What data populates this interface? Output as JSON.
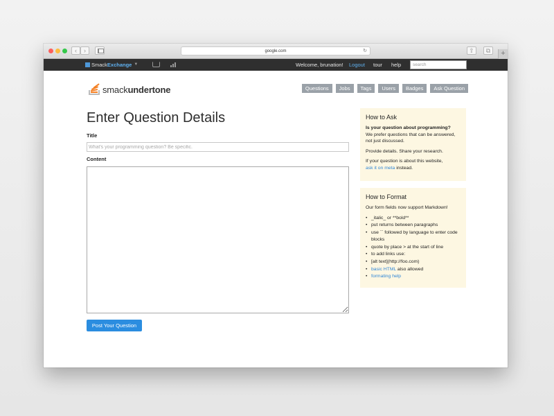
{
  "browser": {
    "url": "google.com",
    "traffic_colors": [
      "#fc605c",
      "#fdbc40",
      "#34c84a"
    ],
    "back_icon": "‹",
    "forward_icon": "›",
    "reload_icon": "↻",
    "share_icon": "⇪",
    "tabs_icon": "⧉",
    "new_tab_icon": "+"
  },
  "topbar": {
    "brand_a": "Smack",
    "brand_b": "Exchange",
    "caret": "▼",
    "welcome": "Welcome, brunation!",
    "logout": "Logout",
    "tour": "tour",
    "help": "help",
    "search_placeholder": "search",
    "accent": "#5fb0ef"
  },
  "site": {
    "name_a": "smack",
    "name_b": "undertone",
    "nav": [
      "Questions",
      "Jobs",
      "Tags",
      "Users",
      "Badges",
      "Ask Question"
    ],
    "logo_colors": [
      "#bcbbbb",
      "#f48024"
    ]
  },
  "form": {
    "heading": "Enter Question Details",
    "title_label": "Title",
    "title_placeholder": "What's your programming question? Be specific.",
    "content_label": "Content",
    "submit": "Post Your Question",
    "submit_color": "#2b8de0"
  },
  "how_to_ask": {
    "heading": "How to Ask",
    "q": "Is your question about programming?",
    "p1": "We prefer questions that can be answered, not just discussed.",
    "p2": "Provide details. Share your research.",
    "p3_pre": "If your question is about this website,",
    "p3_link": "ask it on meta",
    "p3_post": " instead.",
    "bg": "#fdf7e2"
  },
  "how_to_format": {
    "heading": "How to Format",
    "intro": "Our form fields now support Markdown!",
    "items": [
      "_italic_ or **bold**",
      "put returns between paragraphs",
      "use `` followed by language to enter code blocks",
      "quote by place > at the start of line",
      "to add links use:",
      "[alt text](http://foo.com)"
    ],
    "link_html": "basic HTML",
    "link_html_post": " also allowed",
    "link_help": "formating help"
  }
}
